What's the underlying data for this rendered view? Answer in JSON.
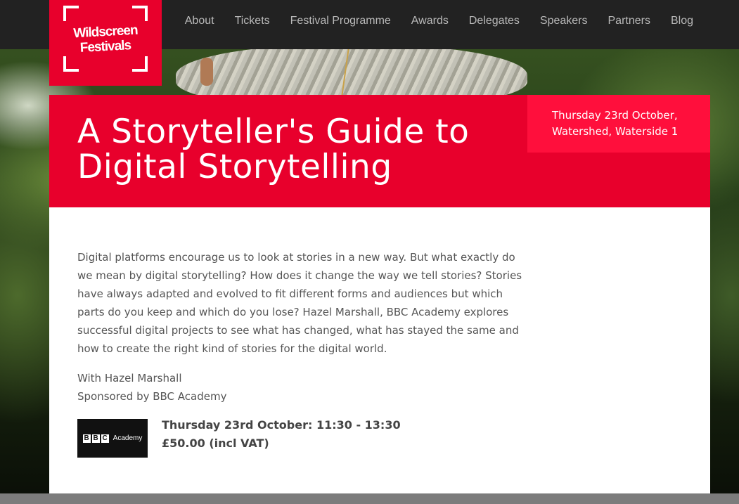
{
  "site": {
    "logo_line1": "Wildscreen",
    "logo_line2": "Festivals"
  },
  "nav": {
    "items": [
      "About",
      "Tickets",
      "Festival Programme",
      "Awards",
      "Delegates",
      "Speakers",
      "Partners",
      "Blog"
    ]
  },
  "event": {
    "title": "A Storyteller's Guide to Digital Storytelling",
    "date_line": "Thursday 23rd October,",
    "venue_line": "Watershed, Waterside 1",
    "description": "Digital platforms encourage us to look at stories in a new way. But what exactly do we mean by digital storytelling? How does it change the way we tell stories? Stories have always adapted and evolved to fit different forms and audiences but which parts do you keep and which do you lose? Hazel Marshall, BBC Academy explores successful digital projects to see what has changed, what has stayed the same and how to create the right kind of stories for the digital world.",
    "with": "With Hazel Marshall",
    "sponsored_by": "Sponsored by BBC Academy",
    "session_time": "Thursday 23rd October: 11:30 - 13:30",
    "price": "£50.00 (incl VAT)"
  },
  "sponsor_logo": {
    "letters": [
      "B",
      "B",
      "C"
    ],
    "word": "Academy"
  },
  "colors": {
    "brand_red": "#e8002c",
    "nav_bg": "#222222",
    "nav_text": "#b9b9b9"
  }
}
